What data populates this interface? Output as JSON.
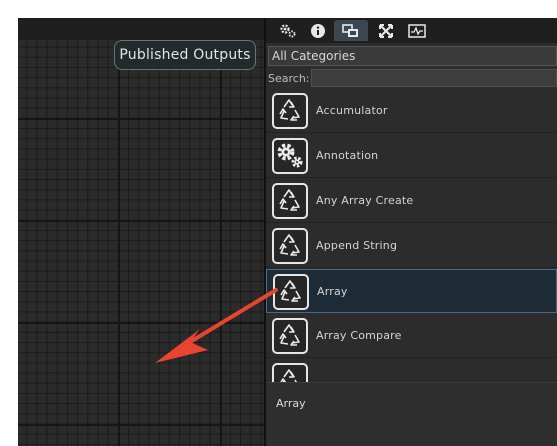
{
  "canvas": {
    "published_outputs_label": "Published Outputs"
  },
  "toolbar": {
    "tools": [
      {
        "icon": "gears-icon",
        "glyph": "⚙"
      },
      {
        "icon": "info-icon",
        "glyph": "ℹ"
      },
      {
        "icon": "nodes-icon",
        "glyph": "▦"
      },
      {
        "icon": "expand-icon",
        "glyph": "✕"
      },
      {
        "icon": "monitor-icon",
        "glyph": "⏦"
      }
    ],
    "active_index": 2
  },
  "library": {
    "category": "All Categories",
    "search_label": "Search:",
    "search_value": "",
    "items": [
      {
        "label": "Accumulator",
        "icon": "recycle-icon"
      },
      {
        "label": "Annotation",
        "icon": "gears-icon"
      },
      {
        "label": "Any Array Create",
        "icon": "recycle-icon"
      },
      {
        "label": "Append String",
        "icon": "recycle-icon"
      },
      {
        "label": "Array",
        "icon": "recycle-icon"
      },
      {
        "label": "Array Compare",
        "icon": "recycle-icon"
      },
      {
        "label": "",
        "icon": "recycle-icon"
      }
    ],
    "selected_index": 4
  },
  "status": {
    "selected_name": "Array"
  },
  "colors": {
    "arrow": "#e8442f",
    "selection_bg": "#1d2b36"
  }
}
